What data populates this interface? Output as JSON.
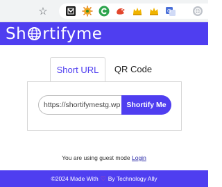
{
  "browser": {
    "bookmark_icon": "star-outline-icon",
    "extensions": [
      {
        "name": "extension-icon-1",
        "color": "#222222"
      },
      {
        "name": "extension-icon-2",
        "color": "#f2a31b"
      },
      {
        "name": "extension-icon-3",
        "color": "#2da44e"
      },
      {
        "name": "extension-icon-4",
        "color": "#e2462c"
      },
      {
        "name": "extension-icon-5",
        "color": "#f0b400"
      },
      {
        "name": "extension-icon-6",
        "color": "#f0b400"
      },
      {
        "name": "extension-icon-7",
        "color": "#4a6fd8"
      },
      {
        "name": "extension-icon-8",
        "color": "#a0a0a0"
      }
    ]
  },
  "app": {
    "logo_prefix": "Sh",
    "logo_suffix": "rtifyme",
    "brand_color": "#4f3ef0"
  },
  "tabs": [
    {
      "label": "Short URL",
      "active": true
    },
    {
      "label": "QR Code",
      "active": false
    }
  ],
  "form": {
    "url_value": "https://shortifymestg.wp",
    "button_label": "Shortify Me"
  },
  "guest": {
    "message": "You are using guest mode",
    "login_label": "Login"
  },
  "footer": {
    "prefix": "©2024 Made With",
    "heart_icon": "heart-icon",
    "suffix": "By Technology Ally"
  }
}
